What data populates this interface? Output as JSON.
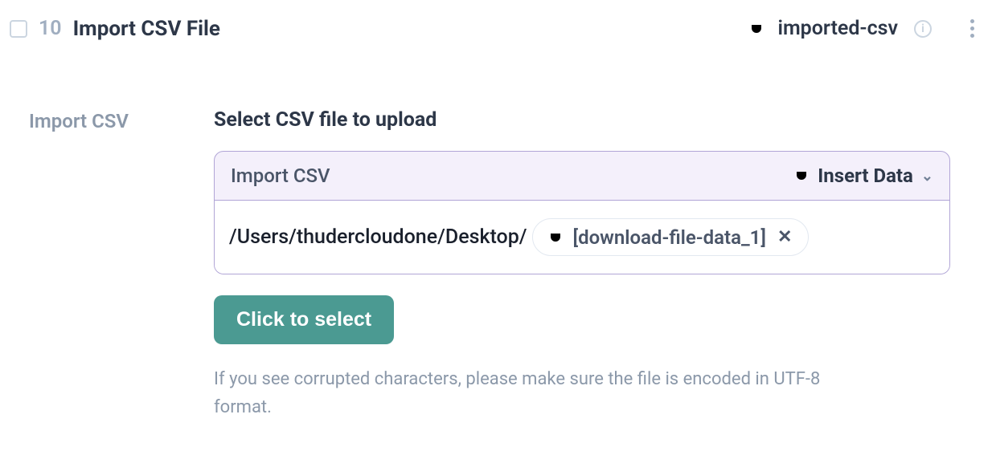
{
  "header": {
    "step_number": "10",
    "title": "Import CSV File",
    "output_name": "imported-csv"
  },
  "side": {
    "label": "Import CSV"
  },
  "field": {
    "title": "Select CSV file to upload",
    "panel_label": "Import CSV",
    "insert_label": "Insert Data",
    "path": "/Users/thudercloudone/Desktop/",
    "chip_text": "[download-file-data_1]"
  },
  "select_button": "Click to select",
  "hint": "If you see corrupted characters, please make sure the file is encoded in UTF-8 format."
}
